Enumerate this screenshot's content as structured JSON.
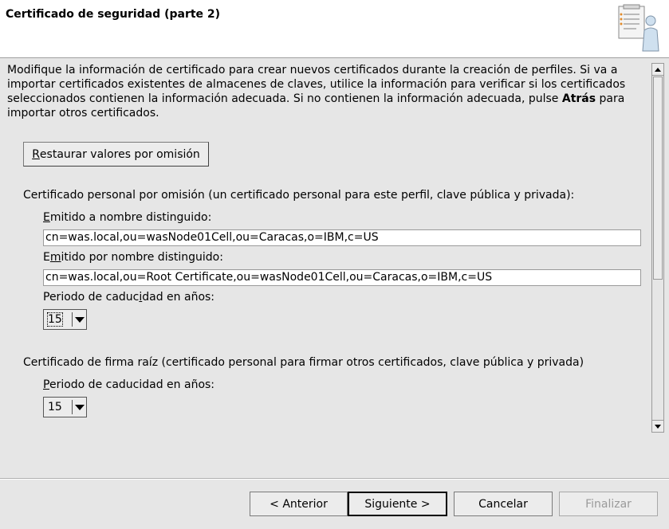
{
  "header": {
    "title": "Certificado de seguridad (parte 2)",
    "icon": "wizard-clipboard-person-icon"
  },
  "intro": {
    "text_before": "Modifique la información de certificado para crear nuevos certificados durante la creación de perfiles. Si va a importar certificados existentes de almacenes de claves, utilice la información para verificar si los certificados seleccionados contienen la información adecuada. Si no contienen la información adecuada, pulse ",
    "bold": "Atrás",
    "text_after": " para importar otros certificados."
  },
  "restore_button": {
    "mnemonic": "R",
    "rest": "estaurar valores por omisión"
  },
  "personal": {
    "heading": "Certificado personal por omisión (un certificado personal para este perfil, clave pública y privada):",
    "issued_to_label_mn": "E",
    "issued_to_label_rest": "mitido a nombre distinguido:",
    "issued_to_value": "cn=was.local,ou=wasNode01Cell,ou=Caracas,o=IBM,c=US",
    "issued_by_label_a": "E",
    "issued_by_label_mn": "m",
    "issued_by_label_rest": "itido por nombre distinguido:",
    "issued_by_value": "cn=was.local,ou=Root Certificate,ou=wasNode01Cell,ou=Caracas,o=IBM,c=US",
    "validity_label_a": "Periodo de caduc",
    "validity_label_mn": "i",
    "validity_label_rest": "dad en años:",
    "validity_value": "15"
  },
  "root": {
    "heading": "Certificado de firma raíz (certificado personal para firmar otros certificados, clave pública y privada)",
    "validity_label_mn": "P",
    "validity_label_rest": "eriodo de caducidad en años:",
    "validity_value": "15"
  },
  "footer": {
    "prev": "< Anterior",
    "next": "Siguiente >",
    "cancel": "Cancelar",
    "finish": "Finalizar"
  }
}
